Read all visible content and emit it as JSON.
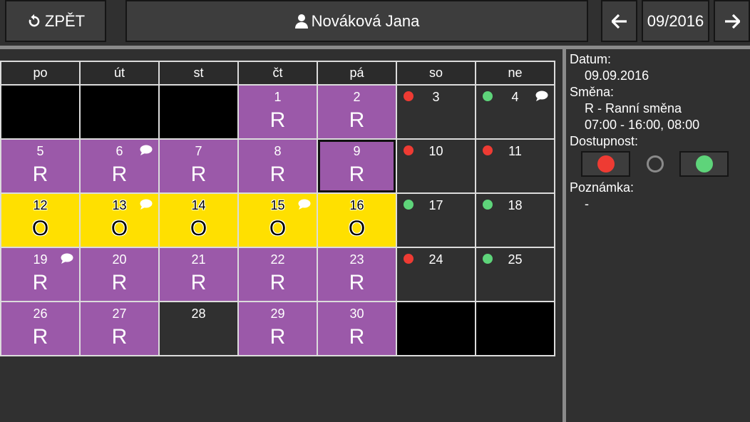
{
  "header": {
    "back_label": "ZPĚT",
    "user_name": "Nováková Jana",
    "month": "09/2016"
  },
  "calendar": {
    "weekdays": [
      "po",
      "út",
      "st",
      "čt",
      "pá",
      "so",
      "ne"
    ],
    "weeks": [
      [
        {
          "type": "empty"
        },
        {
          "type": "empty"
        },
        {
          "type": "empty"
        },
        {
          "type": "purple",
          "day": "1",
          "code": "R"
        },
        {
          "type": "purple",
          "day": "2",
          "code": "R"
        },
        {
          "type": "off",
          "day": "3",
          "dot": "red"
        },
        {
          "type": "off",
          "day": "4",
          "dot": "green",
          "note": true
        }
      ],
      [
        {
          "type": "purple",
          "day": "5",
          "code": "R"
        },
        {
          "type": "purple",
          "day": "6",
          "code": "R",
          "note": true
        },
        {
          "type": "purple",
          "day": "7",
          "code": "R"
        },
        {
          "type": "purple",
          "day": "8",
          "code": "R"
        },
        {
          "type": "purple",
          "day": "9",
          "code": "R",
          "selected": true
        },
        {
          "type": "off",
          "day": "10",
          "dot": "red"
        },
        {
          "type": "off",
          "day": "11",
          "dot": "red"
        }
      ],
      [
        {
          "type": "yellow",
          "day": "12",
          "code": "O"
        },
        {
          "type": "yellow",
          "day": "13",
          "code": "O",
          "note": true
        },
        {
          "type": "yellow",
          "day": "14",
          "code": "O"
        },
        {
          "type": "yellow",
          "day": "15",
          "code": "O",
          "note": true
        },
        {
          "type": "yellow",
          "day": "16",
          "code": "O"
        },
        {
          "type": "off",
          "day": "17",
          "dot": "green"
        },
        {
          "type": "off",
          "day": "18",
          "dot": "green"
        }
      ],
      [
        {
          "type": "purple",
          "day": "19",
          "code": "R",
          "note": true
        },
        {
          "type": "purple",
          "day": "20",
          "code": "R"
        },
        {
          "type": "purple",
          "day": "21",
          "code": "R"
        },
        {
          "type": "purple",
          "day": "22",
          "code": "R"
        },
        {
          "type": "purple",
          "day": "23",
          "code": "R"
        },
        {
          "type": "off",
          "day": "24",
          "dot": "red"
        },
        {
          "type": "off",
          "day": "25",
          "dot": "green"
        }
      ],
      [
        {
          "type": "purple",
          "day": "26",
          "code": "R"
        },
        {
          "type": "purple",
          "day": "27",
          "code": "R"
        },
        {
          "type": "off",
          "day": "28"
        },
        {
          "type": "purple",
          "day": "29",
          "code": "R"
        },
        {
          "type": "purple",
          "day": "30",
          "code": "R"
        },
        {
          "type": "empty"
        },
        {
          "type": "empty"
        }
      ]
    ]
  },
  "detail": {
    "date_label": "Datum:",
    "date_value": "09.09.2016",
    "shift_label": "Směna:",
    "shift_name": "R - Ranní směna",
    "shift_time": "07:00 - 16:00, 08:00",
    "availability_label": "Dostupnost:",
    "availability_options": [
      "unavailable",
      "neutral",
      "available"
    ],
    "note_label": "Poznámka:",
    "note_value": "-"
  },
  "colors": {
    "purple": "#9b59a9",
    "yellow": "#ffe000",
    "red_dot": "#ee3b33",
    "green_dot": "#5ed47a",
    "background": "#303030"
  },
  "icons": {
    "back": "undo-arrow-icon",
    "user": "user-icon",
    "prev": "arrow-left-icon",
    "next": "arrow-right-icon",
    "note": "speech-bubble-icon"
  }
}
